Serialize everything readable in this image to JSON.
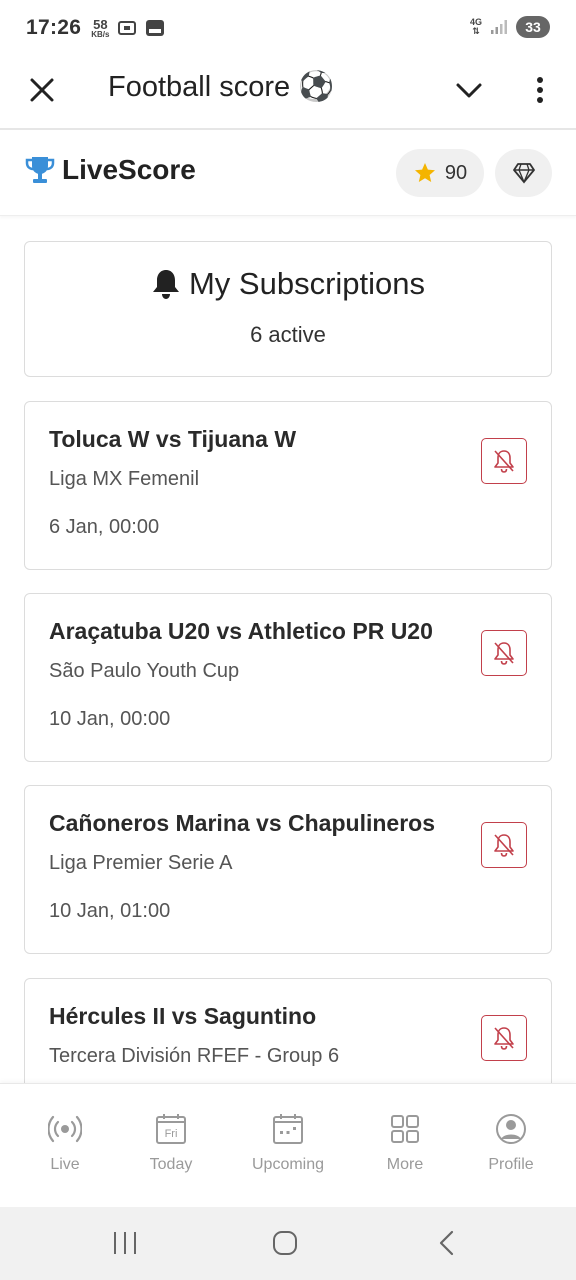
{
  "status_bar": {
    "time": "17:26",
    "speed_value": "58",
    "speed_unit": "KB/s",
    "network": "4G",
    "battery": "33"
  },
  "app_bar": {
    "title": "Football score ⚽"
  },
  "livescore": {
    "brand": "LiveScore",
    "points": "90"
  },
  "subscriptions": {
    "title": "My Subscriptions",
    "count": "6 active",
    "matches": [
      {
        "title": "Toluca W vs Tijuana W",
        "league": "Liga MX Femenil",
        "time": "6 Jan, 00:00"
      },
      {
        "title": "Araçatuba U20 vs Athletico PR U20",
        "league": "São Paulo Youth Cup",
        "time": "10 Jan, 00:00"
      },
      {
        "title": "Cañoneros Marina vs Chapulineros",
        "league": "Liga Premier Serie A",
        "time": "10 Jan, 01:00"
      },
      {
        "title": "Hércules II vs Saguntino",
        "league": "Tercera División RFEF - Group 6",
        "time": ""
      }
    ]
  },
  "bottom_nav": {
    "items": [
      {
        "label": "Live",
        "icon": "live-icon"
      },
      {
        "label": "Today",
        "icon": "calendar-day-icon",
        "day": "Fri"
      },
      {
        "label": "Upcoming",
        "icon": "calendar-icon"
      },
      {
        "label": "More",
        "icon": "grid-icon"
      },
      {
        "label": "Profile",
        "icon": "profile-icon"
      }
    ]
  },
  "colors": {
    "accent_red": "#c2404b",
    "trophy_blue": "#3a8fd8",
    "star_yellow": "#f4b400",
    "nav_gray": "#9a9a9a"
  }
}
